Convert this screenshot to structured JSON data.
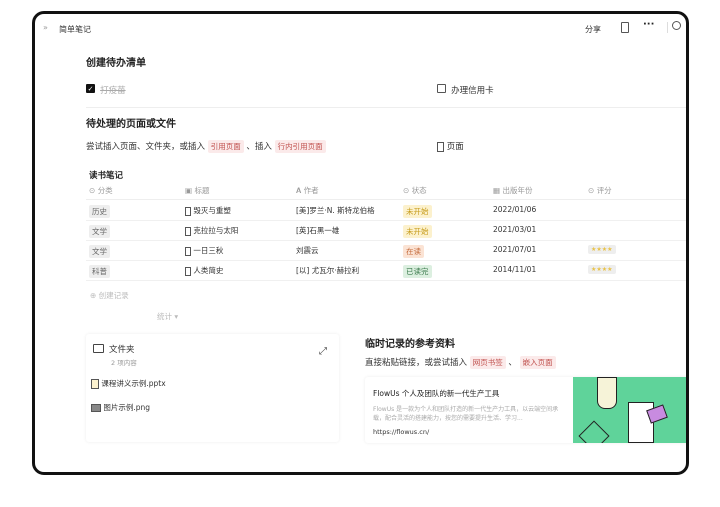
{
  "header": {
    "breadcrumb": "简单笔记",
    "share": "分享"
  },
  "todo": {
    "title": "创建待办清单",
    "items": [
      {
        "label": "打疫苗",
        "checked": true
      },
      {
        "label": "办理信用卡",
        "checked": false
      }
    ]
  },
  "pending": {
    "title": "待处理的页面或文件",
    "text": "尝试插入页面、文件夹，或插入",
    "ref1": "引用页面",
    "sep": "、插入",
    "ref2": "行内引用页面",
    "page": "页面"
  },
  "table": {
    "title": "读书笔记",
    "columns": [
      "分类",
      "标题",
      "作者",
      "状态",
      "出版年份",
      "评分"
    ],
    "rows": [
      {
        "category": "历史",
        "title": "毁灭与重塑",
        "author": "[美]罗兰·N. 斯特龙伯格",
        "status": "未开始",
        "status_color": "yellow",
        "date": "2022/01/06",
        "rating": ""
      },
      {
        "category": "文学",
        "title": "克拉拉与太阳",
        "author": "[英]石黑一雄",
        "status": "未开始",
        "status_color": "yellow",
        "date": "2021/03/01",
        "rating": ""
      },
      {
        "category": "文学",
        "title": "一日三秋",
        "author": "刘震云",
        "status": "在读",
        "status_color": "orange",
        "date": "2021/07/01",
        "rating": "★★★★"
      },
      {
        "category": "科普",
        "title": "人类简史",
        "author": "[以] 尤瓦尔·赫拉利",
        "status": "已读完",
        "status_color": "green",
        "date": "2014/11/01",
        "rating": "★★★★"
      }
    ],
    "create": "创建记录",
    "stats": "统计 ▾"
  },
  "folder": {
    "name": "文件夹",
    "count": "2 项内容",
    "files": [
      {
        "name": "课程讲义示例.pptx",
        "icon": "pptx-file-icon"
      },
      {
        "name": "图片示例.png",
        "icon": "image-file-icon"
      }
    ]
  },
  "refs": {
    "title": "临时记录的参考资料",
    "text": "直接粘贴链接，或尝试插入",
    "tag1": "网页书签",
    "sep": "、",
    "tag2": "嵌入页面",
    "bookmark": {
      "title": "FlowUs 个人及团队的新一代生产工具",
      "desc": "FlowUs 是一款为个人和团队打造的新一代生产力工具，以云端空间承载，配合灵活的搭建能力，按您的需要提升生活、学习...",
      "url": "https://flowus.cn/"
    }
  }
}
